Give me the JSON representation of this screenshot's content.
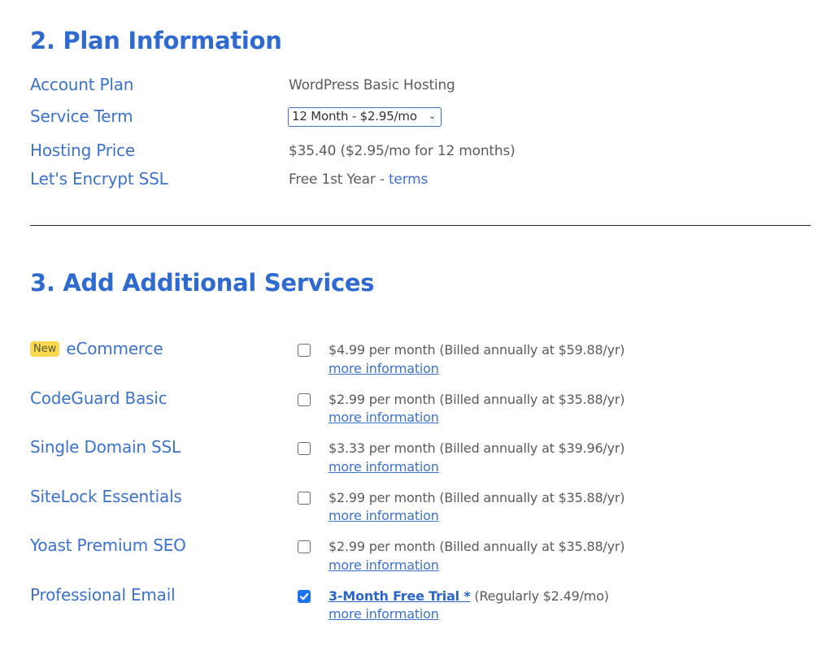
{
  "plan_section": {
    "title": "2. Plan Information",
    "rows": {
      "account_plan": {
        "label": "Account Plan",
        "value": "WordPress Basic Hosting"
      },
      "service_term": {
        "label": "Service Term",
        "selected": "12 Month - $2.95/mo"
      },
      "hosting_price": {
        "label": "Hosting Price",
        "value": "$35.40 ($2.95/mo for 12 months)"
      },
      "ssl": {
        "label": "Let's Encrypt SSL",
        "value": "Free 1st Year - ",
        "link": "terms"
      }
    }
  },
  "services_section": {
    "title": "3. Add Additional Services",
    "new_badge": "New",
    "more_info_label": "more information",
    "items": [
      {
        "name": "eCommerce",
        "checked": false,
        "price": "$4.99 per month (Billed annually at $59.88/yr)"
      },
      {
        "name": "CodeGuard Basic",
        "checked": false,
        "price": "$2.99 per month (Billed annually at $35.88/yr)"
      },
      {
        "name": "Single Domain SSL",
        "checked": false,
        "price": "$3.33 per month (Billed annually at $39.96/yr)"
      },
      {
        "name": "SiteLock Essentials",
        "checked": false,
        "price": "$2.99 per month (Billed annually at $35.88/yr)"
      },
      {
        "name": "Yoast Premium SEO",
        "checked": false,
        "price": "$2.99 per month (Billed annually at $35.88/yr)"
      },
      {
        "name": "Professional Email",
        "checked": true,
        "trial_link": "3-Month Free Trial *",
        "price": " (Regularly $2.49/mo)"
      }
    ]
  },
  "colors": {
    "heading": "#2f6ad0",
    "label": "#3d72cc",
    "value_text": "#5b5b5b",
    "badge_bg": "#fcd94e",
    "checkbox_checked": "#1a73e8"
  }
}
